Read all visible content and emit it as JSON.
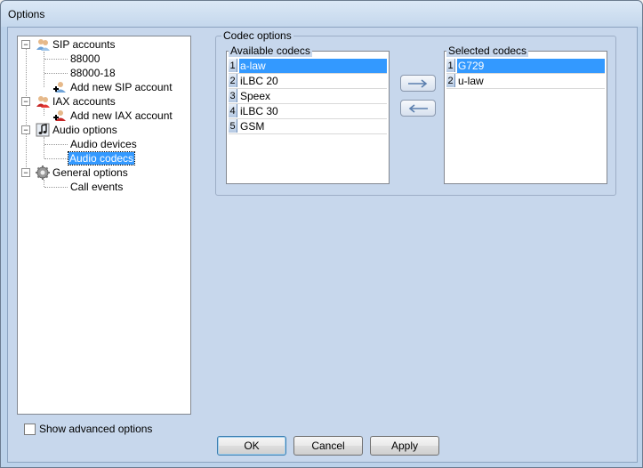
{
  "window": {
    "title": "Options"
  },
  "tree": {
    "items": [
      {
        "label": "SIP accounts",
        "icon": "users-icon"
      },
      {
        "label": "88000"
      },
      {
        "label": "88000-18"
      },
      {
        "label": "Add new SIP account",
        "icon": "add-user-icon"
      },
      {
        "label": "IAX accounts",
        "icon": "users-red-icon"
      },
      {
        "label": "Add new IAX account",
        "icon": "add-user-red-icon"
      },
      {
        "label": "Audio options",
        "icon": "music-note-icon"
      },
      {
        "label": "Audio devices"
      },
      {
        "label": "Audio codecs",
        "selected": true
      },
      {
        "label": "General options",
        "icon": "gear-icon"
      },
      {
        "label": "Call events"
      }
    ]
  },
  "show_advanced": {
    "label": "Show advanced options",
    "checked": false
  },
  "codec_options": {
    "title": "Codec options",
    "available": {
      "header": "Available codecs",
      "items": [
        {
          "num": "1",
          "name": "a-law",
          "selected": true
        },
        {
          "num": "2",
          "name": "iLBC 20"
        },
        {
          "num": "3",
          "name": "Speex"
        },
        {
          "num": "4",
          "name": "iLBC 30"
        },
        {
          "num": "5",
          "name": "GSM"
        }
      ]
    },
    "selected": {
      "header": "Selected codecs",
      "items": [
        {
          "num": "1",
          "name": "G729",
          "selected": true
        },
        {
          "num": "2",
          "name": "u-law"
        }
      ]
    }
  },
  "buttons": {
    "ok": "OK",
    "cancel": "Cancel",
    "apply": "Apply"
  },
  "colors": {
    "selection": "#3399ff",
    "panel": "#c7d7ec"
  }
}
